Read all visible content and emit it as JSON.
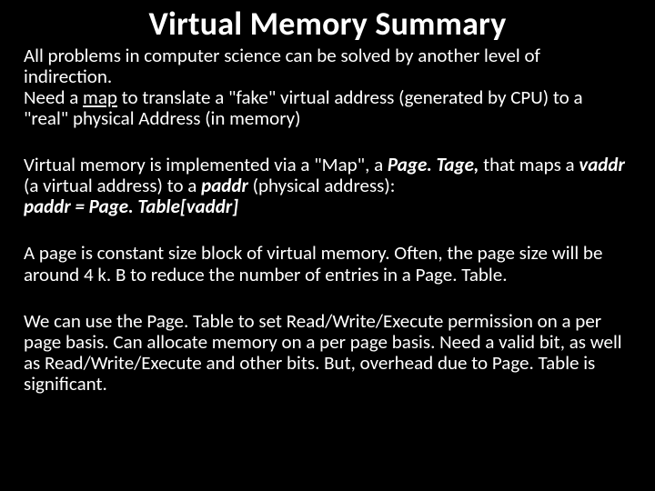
{
  "title": "Virtual Memory Summary",
  "p1": {
    "t1": "All problems in computer science can be solved by another level of indirection.",
    "t2a": "Need a ",
    "map": "map",
    "t2b": " to translate a \"fake\" virtual address (generated by CPU) to a \"real\" physical Address (in memory)"
  },
  "p2": {
    "t1a": "Virtual memory is implemented via a \"Map\", a ",
    "pagetage": "Page. Tage,",
    "t1b": " that maps a ",
    "vaddr": "vaddr",
    "t1c": " (a virtual address) to a ",
    "paddr": "paddr",
    "t1d": " (physical address):",
    "eq": "paddr = Page. Table[vaddr]"
  },
  "p3": "A page is constant size block of virtual memory.  Often, the page size will be around 4 k. B to reduce the number of entries in a Page. Table.",
  "p4": "We can use the Page. Table to set Read/Write/Execute permission on a per page basis.  Can allocate memory on a per page basis.  Need a valid bit, as well as Read/Write/Execute and other bits.  But, overhead due to Page. Table is significant."
}
